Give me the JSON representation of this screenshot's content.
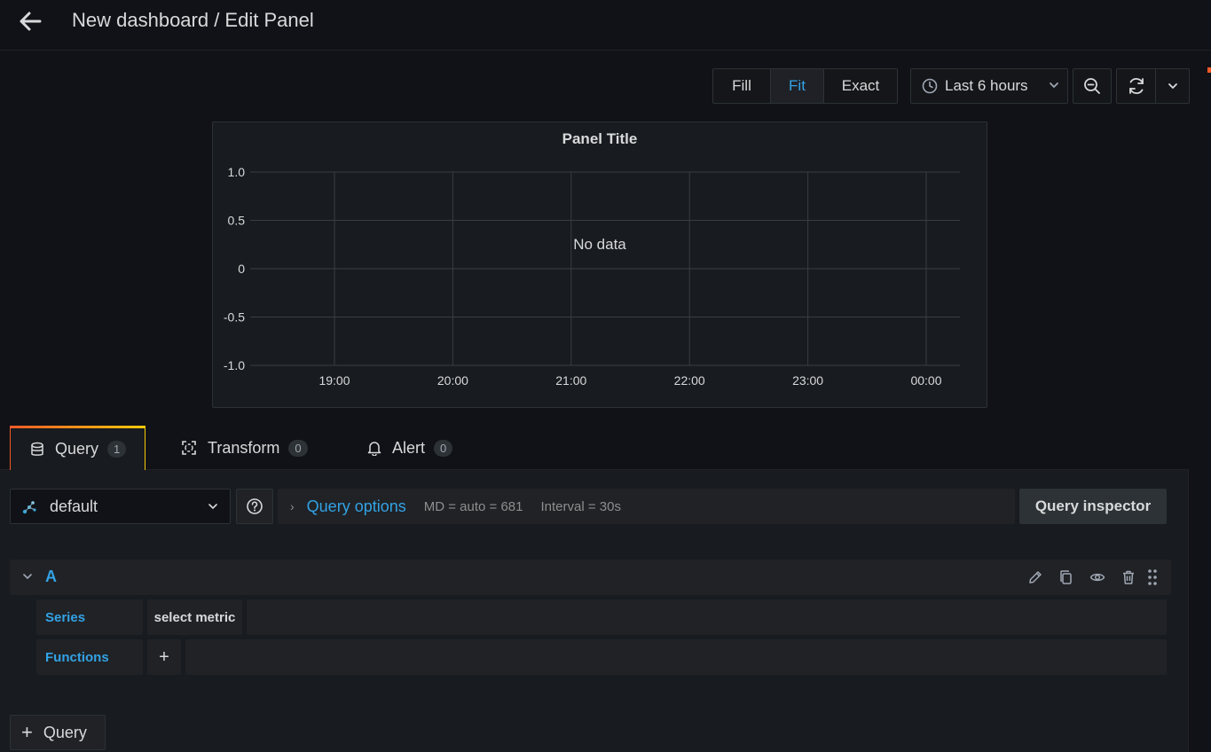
{
  "header": {
    "title": "New dashboard / Edit Panel"
  },
  "toolbar": {
    "view_modes": [
      "Fill",
      "Fit",
      "Exact"
    ],
    "active_view_mode": "Fit",
    "time_range": "Last 6 hours"
  },
  "panel": {
    "title": "Panel Title",
    "no_data": "No data"
  },
  "chart_data": {
    "type": "line",
    "title": "Panel Title",
    "x": [
      "19:00",
      "20:00",
      "21:00",
      "22:00",
      "23:00",
      "00:00"
    ],
    "y_ticks": [
      "1.0",
      "0.5",
      "0",
      "-0.5",
      "-1.0"
    ],
    "ylim": [
      -1.0,
      1.0
    ],
    "series": [],
    "grid": true,
    "annotation": "No data"
  },
  "tabs": [
    {
      "label": "Query",
      "count": "1"
    },
    {
      "label": "Transform",
      "count": "0"
    },
    {
      "label": "Alert",
      "count": "0"
    }
  ],
  "query_editor": {
    "datasource": "default",
    "options_label": "Query options",
    "max_data_points": "MD = auto = 681",
    "interval": "Interval = 30s",
    "inspector_label": "Query inspector",
    "query_ref": "A",
    "series_label": "Series",
    "series_value": "select metric",
    "functions_label": "Functions",
    "functions_add": "+",
    "add_query_label": "Query"
  },
  "colors": {
    "background": "#111217",
    "panel": "#181b1f",
    "accent_blue": "#33a2e5",
    "tab_gradient_start": "#f05a28",
    "tab_gradient_end": "#fbca0a"
  }
}
